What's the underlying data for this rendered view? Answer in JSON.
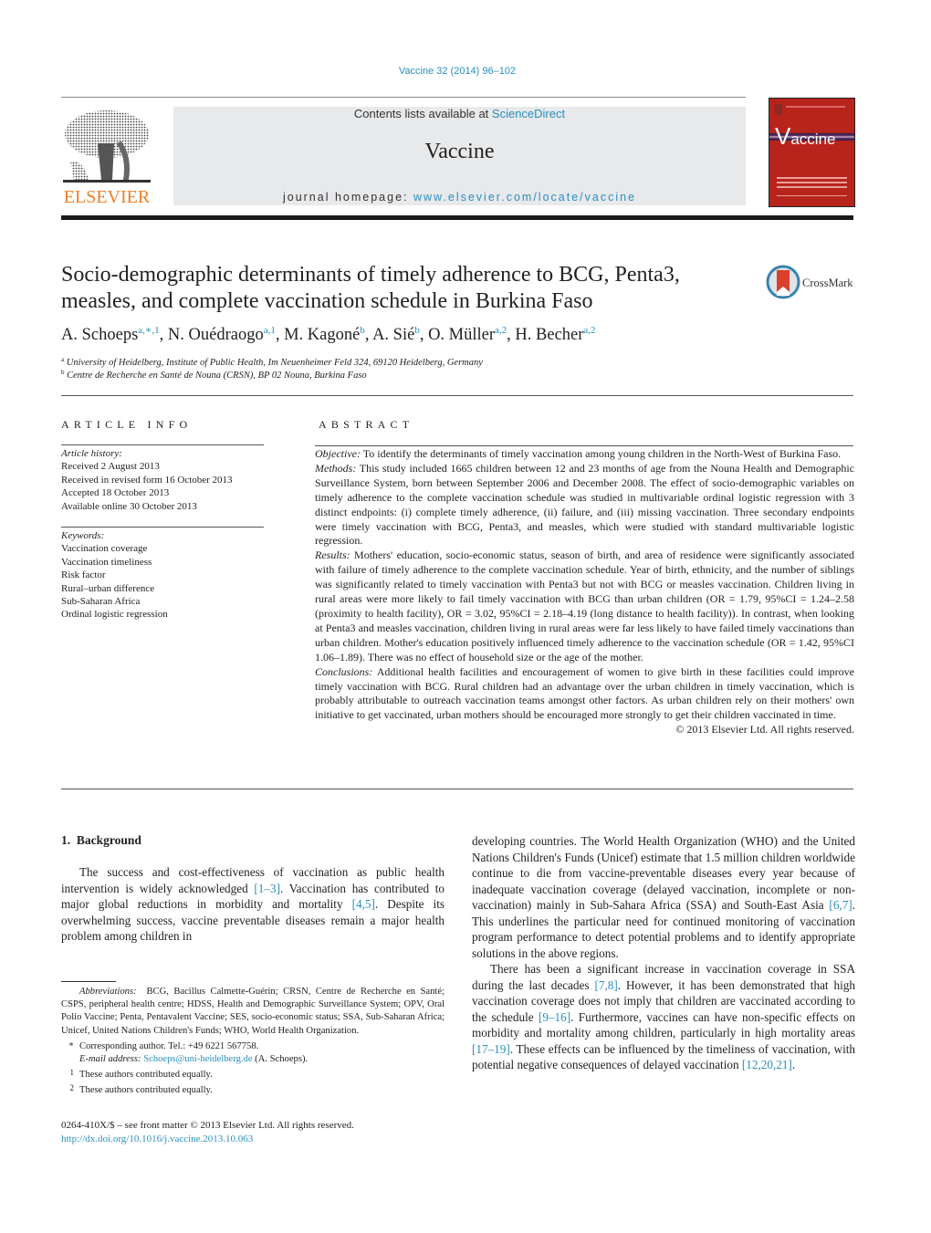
{
  "header": {
    "journal_ref": "Vaccine 32 (2014) 96–102",
    "contents_prefix": "Contents lists available at ",
    "contents_link": "ScienceDirect",
    "journal_name": "Vaccine",
    "homepage_prefix": "journal homepage: ",
    "homepage_url": "www.elsevier.com/locate/vaccine",
    "publisher_logo_text": "ELSEVIER",
    "cover_title": "accine",
    "cover_title_initial": "V",
    "crossmark_label": "CrossMark"
  },
  "article": {
    "title": "Socio-demographic determinants of timely adherence to BCG, Penta3, measles, and complete vaccination schedule in Burkina Faso",
    "authors": [
      {
        "name": "A. Schoeps",
        "sup": "a,∗,1"
      },
      {
        "name": "N. Ouédraogo",
        "sup": "a,1"
      },
      {
        "name": "M. Kagoné",
        "sup": "b"
      },
      {
        "name": "A. Sié",
        "sup": "b"
      },
      {
        "name": "O. Müller",
        "sup": "a,2"
      },
      {
        "name": "H. Becher",
        "sup": "a,2"
      }
    ],
    "affiliations": [
      {
        "mark": "a",
        "text": "University of Heidelberg, Institute of Public Health, Im Neuenheimer Feld 324, 69120 Heidelberg, Germany"
      },
      {
        "mark": "b",
        "text": "Centre de Recherche en Santé de Nouna (CRSN), BP 02 Nouna, Burkina Faso"
      }
    ]
  },
  "article_info": {
    "heading": "ARTICLE INFO",
    "history_label": "Article history:",
    "history": [
      "Received 2 August 2013",
      "Received in revised form 16 October 2013",
      "Accepted 18 October 2013",
      "Available online 30 October 2013"
    ],
    "keywords_label": "Keywords:",
    "keywords": [
      "Vaccination coverage",
      "Vaccination timeliness",
      "Risk factor",
      "Rural–urban difference",
      "Sub-Saharan Africa",
      "Ordinal logistic regression"
    ]
  },
  "abstract": {
    "heading": "ABSTRACT",
    "sections": [
      {
        "label": "Objective:",
        "text": " To identify the determinants of timely vaccination among young children in the North-West of Burkina Faso."
      },
      {
        "label": "Methods:",
        "text": " This study included 1665 children between 12 and 23 months of age from the Nouna Health and Demographic Surveillance System, born between September 2006 and December 2008. The effect of socio-demographic variables on timely adherence to the complete vaccination schedule was studied in multivariable ordinal logistic regression with 3 distinct endpoints: (i) complete timely adherence, (ii) failure, and (iii) missing vaccination. Three secondary endpoints were timely vaccination with BCG, Penta3, and measles, which were studied with standard multivariable logistic regression."
      },
      {
        "label": "Results:",
        "text": " Mothers' education, socio-economic status, season of birth, and area of residence were significantly associated with failure of timely adherence to the complete vaccination schedule. Year of birth, ethnicity, and the number of siblings was significantly related to timely vaccination with Penta3 but not with BCG or measles vaccination. Children living in rural areas were more likely to fail timely vaccination with BCG than urban children (OR = 1.79, 95%CI = 1.24–2.58 (proximity to health facility), OR = 3.02, 95%CI = 2.18–4.19 (long distance to health facility)). In contrast, when looking at Penta3 and measles vaccination, children living in rural areas were far less likely to have failed timely vaccinations than urban children. Mother's education positively influenced timely adherence to the vaccination schedule (OR = 1.42, 95%CI 1.06–1.89). There was no effect of household size or the age of the mother."
      },
      {
        "label": "Conclusions:",
        "text": " Additional health facilities and encouragement of women to give birth in these facilities could improve timely vaccination with BCG. Rural children had an advantage over the urban children in timely vaccination, which is probably attributable to outreach vaccination teams amongst other factors. As urban children rely on their mothers' own initiative to get vaccinated, urban mothers should be encouraged more strongly to get their children vaccinated in time."
      }
    ],
    "copyright": "© 2013 Elsevier Ltd. All rights reserved."
  },
  "body": {
    "section_number": "1.",
    "section_title": "Background",
    "left_para": [
      {
        "t": "The success and cost-effectiveness of vaccination as public health intervention is widely acknowledged "
      },
      {
        "ref": "[1–3]"
      },
      {
        "t": ". Vaccination has contributed to major global reductions in morbidity and mortality "
      },
      {
        "ref": "[4,5]"
      },
      {
        "t": ". Despite its overwhelming success, vaccine preventable diseases remain a major health problem among children in"
      }
    ],
    "right_para1": [
      {
        "t": "developing countries. The World Health Organization (WHO) and the United Nations Children's Funds (Unicef) estimate that 1.5 million children worldwide continue to die from vaccine-preventable diseases every year because of inadequate vaccination coverage (delayed vaccination, incomplete or non-vaccination) mainly in Sub-Sahara Africa (SSA) and South-East Asia "
      },
      {
        "ref": "[6,7]"
      },
      {
        "t": ". This underlines the particular need for continued monitoring of vaccination program performance to detect potential problems and to identify appropriate solutions in the above regions."
      }
    ],
    "right_para2": [
      {
        "t": "There has been a significant increase in vaccination coverage in SSA during the last decades "
      },
      {
        "ref": "[7,8]"
      },
      {
        "t": ". However, it has been demonstrated that high vaccination coverage does not imply that children are vaccinated according to the schedule "
      },
      {
        "ref": "[9–16]"
      },
      {
        "t": ". Furthermore, vaccines can have non-specific effects on morbidity and mortality among children, particularly in high mortality areas "
      },
      {
        "ref": "[17–19]"
      },
      {
        "t": ". These effects can be influenced by the timeliness of vaccination, with potential negative consequences of delayed vaccination "
      },
      {
        "ref": "[12,20,21]"
      },
      {
        "t": "."
      }
    ]
  },
  "footnotes": {
    "abbreviations_label": "Abbreviations:",
    "abbreviations": "BCG, Bacillus Calmette-Guérin; CRSN, Centre de Recherche en Santé; CSPS, peripheral health centre; HDSS, Health and Demographic Surveillance System; OPV, Oral Polio Vaccine; Penta, Pentavalent Vaccine; SES, socio-economic status; SSA, Sub-Saharan Africa; Unicef, United Nations Children's Funds; WHO, World Health Organization.",
    "corresponding_mark": "∗",
    "corresponding": "Corresponding author. Tel.: +49 6221 567758.",
    "email_label": "E-mail address:",
    "email": "Schoeps@uni-heidelberg.de",
    "email_suffix": " (A. Schoeps).",
    "note1_mark": "1",
    "note1": "These authors contributed equally.",
    "note2_mark": "2",
    "note2": "These authors contributed equally."
  },
  "front_matter": {
    "issn_line": "0264-410X/$ – see front matter © 2013 Elsevier Ltd. All rights reserved.",
    "doi": "http://dx.doi.org/10.1016/j.vaccine.2013.10.063"
  }
}
